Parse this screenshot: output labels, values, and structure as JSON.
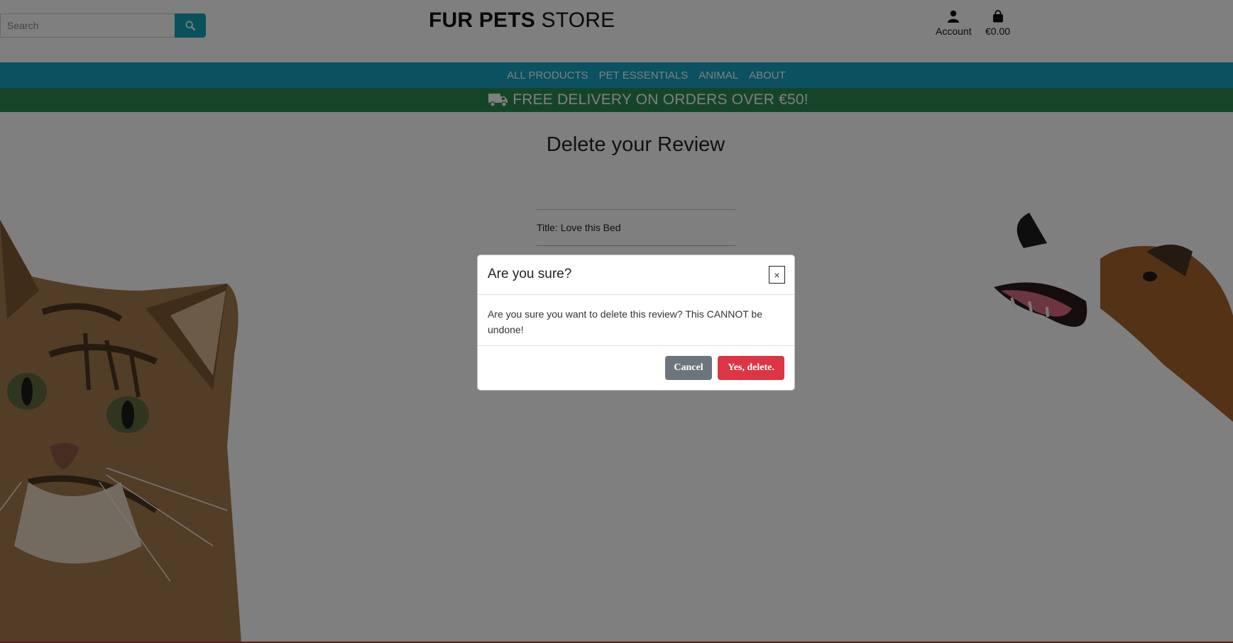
{
  "header": {
    "search": {
      "placeholder": "Search"
    },
    "brand": {
      "bold": "FUR PETS",
      "regular": "STORE"
    },
    "account_label": "Account",
    "cart_total": "€0.00"
  },
  "nav": {
    "items": [
      "ALL PRODUCTS",
      "PET ESSENTIALS",
      "ANIMAL",
      "ABOUT"
    ]
  },
  "banner": {
    "text": "FREE DELIVERY ON ORDERS OVER €50!",
    "icon": "truck-icon"
  },
  "main": {
    "title": "Delete your Review",
    "review_title": "Title: Love this Bed"
  },
  "modal": {
    "title": "Are you sure?",
    "close_label": "×",
    "body": "Are you sure you want to delete this review? This CANNOT be undone!",
    "cancel_label": "Cancel",
    "confirm_label": "Yes, delete."
  },
  "colors": {
    "nav": "#16a2c0",
    "banner": "#2a8b52",
    "search_button": "#17a2b8",
    "cancel": "#6c757d",
    "danger": "#dc3545"
  }
}
